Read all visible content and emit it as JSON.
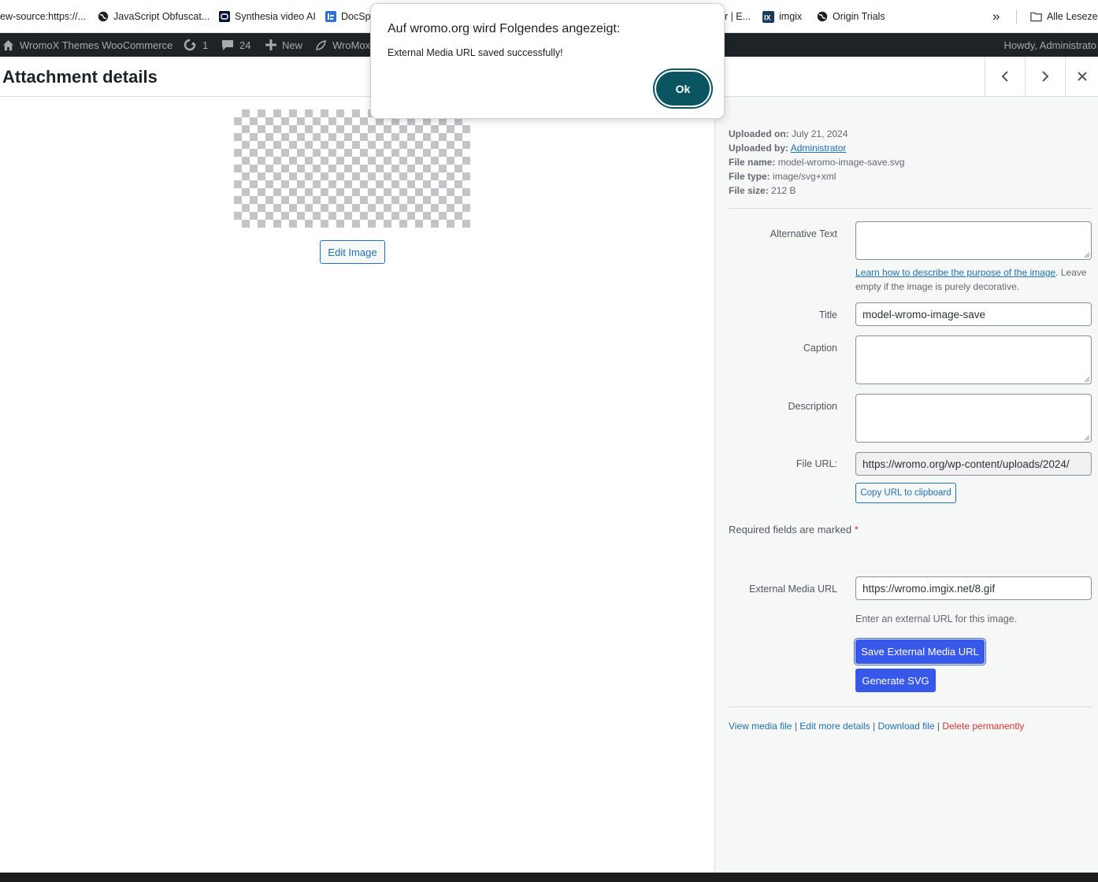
{
  "browser": {
    "bookmarks": [
      {
        "label": "ew-source:https://..."
      },
      {
        "label": "JavaScript Obfuscat..."
      },
      {
        "label": "Synthesia video AI"
      },
      {
        "label": "DocSp"
      },
      {
        "label": "or | E..."
      },
      {
        "label": "imgix"
      },
      {
        "label": "Origin Trials"
      }
    ],
    "more_label": "»",
    "all_bookmarks_label": "Alle Lesezei"
  },
  "adminbar": {
    "site_name": "WromoX Themes WooCommerce",
    "updates_count": "1",
    "comments_count": "24",
    "new_label": "New",
    "plugin_label": "WroMox",
    "howdy": "Howdy, Administrato"
  },
  "modal": {
    "title": "Attachment details"
  },
  "preview": {
    "edit_label": "Edit Image"
  },
  "details": {
    "uploaded_on_label": "Uploaded on:",
    "uploaded_on": "July 21, 2024",
    "uploaded_by_label": "Uploaded by:",
    "uploaded_by": "Administrator",
    "file_name_label": "File name:",
    "file_name": "model-wromo-image-save.svg",
    "file_type_label": "File type:",
    "file_type": "image/svg+xml",
    "file_size_label": "File size:",
    "file_size": "212 B"
  },
  "form": {
    "alt_label": "Alternative Text",
    "alt_value": "",
    "alt_help_link": "Learn how to describe the purpose of the image",
    "alt_help_rest": ". Leave empty if the image is purely decorative.",
    "title_label": "Title",
    "title_value": "model-wromo-image-save",
    "caption_label": "Caption",
    "caption_value": "",
    "description_label": "Description",
    "description_value": "",
    "file_url_label": "File URL:",
    "file_url_value": "https://wromo.org/wp-content/uploads/2024/",
    "copy_url_label": "Copy URL to clipboard",
    "required_note": "Required fields are marked",
    "required_star": "*",
    "ext_url_label": "External Media URL",
    "ext_url_value": "https://wromo.imgix.net/8.gif",
    "ext_url_help": "Enter an external URL for this image.",
    "save_ext_label": "Save External Media URL",
    "generate_svg_label": "Generate SVG"
  },
  "actions": {
    "view": "View media file",
    "edit": "Edit more details",
    "download": "Download file",
    "delete": "Delete permanently",
    "separator": "|"
  },
  "alert": {
    "title": "Auf wromo.org wird Folgendes angezeigt:",
    "message": "External Media URL saved successfully!",
    "ok_label": "Ok"
  },
  "colors": {
    "primary": "#3858e9",
    "link": "#2271b1",
    "delete": "#d63638",
    "dialog_button": "#0b5563",
    "adminbar": "#1d2327"
  }
}
